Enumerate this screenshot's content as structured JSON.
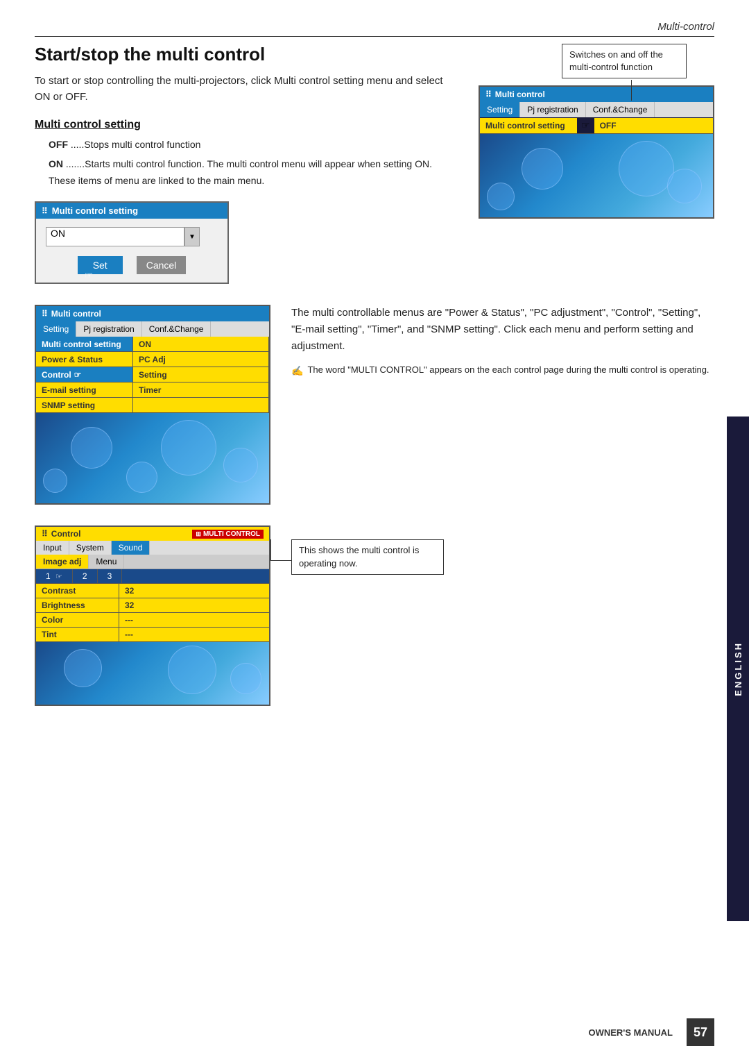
{
  "page": {
    "header": "Multi-control",
    "page_number": "57",
    "footer_label": "OWNER'S MANUAL"
  },
  "section1": {
    "title": "Start/stop the multi control",
    "intro": "To start or stop controlling the multi-projectors, click Multi control setting menu and select ON or OFF.",
    "subsection_title": "Multi control setting",
    "items": [
      {
        "label": "OFF",
        "desc": ".....Stops multi control function"
      },
      {
        "label": "ON",
        "desc": ".......Starts multi control function. The multi control menu will appear when setting ON. These items of menu are linked to the main menu."
      }
    ],
    "callout": {
      "text": "Switches on and off the multi-control function"
    }
  },
  "dialog_setting": {
    "title": "Multi control setting",
    "icon": "⠿",
    "option": "ON",
    "btn_set": "Set",
    "btn_cancel": "Cancel"
  },
  "mc_panel_top": {
    "title": "Multi control",
    "icon": "⠿",
    "tabs": [
      "Setting",
      "Pj registration",
      "Conf.&Change"
    ],
    "active_tab": "Setting",
    "row_label": "Multi control setting",
    "row_value": "OFF"
  },
  "mc_panel_full": {
    "title": "Multi control",
    "icon": "⠿",
    "tabs": [
      "Setting",
      "Pj registration",
      "Conf.&Change"
    ],
    "active_tab": "Setting",
    "rows": [
      {
        "label": "Multi control setting",
        "value": "ON"
      },
      {
        "label": "Power & Status",
        "value": "PC Adj"
      },
      {
        "label": "Control",
        "value": "Setting"
      },
      {
        "label": "E-mail setting",
        "value": "Timer"
      },
      {
        "label": "SNMP setting",
        "value": ""
      }
    ]
  },
  "section2": {
    "text": "The multi controllable menus are \"Power & Status\", \"PC adjustment\", \"Control\", \"Setting\", \"E-mail setting\", \"Timer\", and \"SNMP setting\". Click each menu and perform setting and adjustment.",
    "note": "The word \"MULTI CONTROL\" appears on the each control page during the multi control is operating."
  },
  "ctrl_panel": {
    "title": "Control",
    "icon": "⠿",
    "badge": "MULTI CONTROL",
    "nav_tabs": [
      "Input",
      "System",
      "Sound"
    ],
    "sub_tabs": [
      "Image adj",
      "Menu"
    ],
    "active_nav": "Input",
    "active_sub": "Image adj",
    "tabs": [
      "1",
      "2",
      "3"
    ],
    "active_data_tab": "1",
    "rows": [
      {
        "label": "Contrast",
        "value": "32"
      },
      {
        "label": "Brightness",
        "value": "32"
      },
      {
        "label": "Color",
        "value": "---"
      },
      {
        "label": "Tint",
        "value": "---"
      }
    ]
  },
  "section3_callout": "This shows the multi control is operating now.",
  "sidebar": {
    "label": "ENGLISH"
  }
}
